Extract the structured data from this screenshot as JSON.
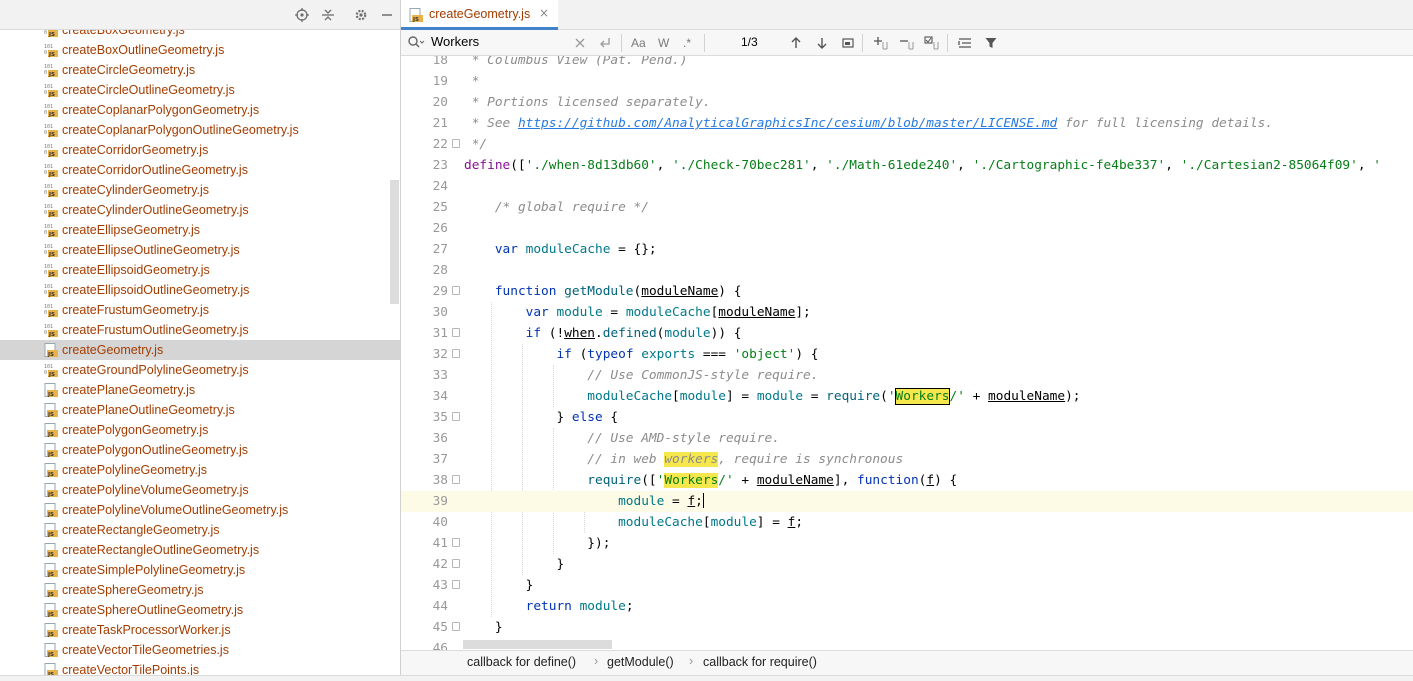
{
  "project_tree": {
    "files": [
      {
        "name": "createBoxGeometry.js",
        "icon": "js-binary-icon"
      },
      {
        "name": "createBoxOutlineGeometry.js",
        "icon": "js-binary-icon"
      },
      {
        "name": "createCircleGeometry.js",
        "icon": "js-binary-icon"
      },
      {
        "name": "createCircleOutlineGeometry.js",
        "icon": "js-binary-icon"
      },
      {
        "name": "createCoplanarPolygonGeometry.js",
        "icon": "js-binary-icon"
      },
      {
        "name": "createCoplanarPolygonOutlineGeometry.js",
        "icon": "js-binary-icon"
      },
      {
        "name": "createCorridorGeometry.js",
        "icon": "js-binary-icon"
      },
      {
        "name": "createCorridorOutlineGeometry.js",
        "icon": "js-binary-icon"
      },
      {
        "name": "createCylinderGeometry.js",
        "icon": "js-binary-icon"
      },
      {
        "name": "createCylinderOutlineGeometry.js",
        "icon": "js-binary-icon"
      },
      {
        "name": "createEllipseGeometry.js",
        "icon": "js-binary-icon"
      },
      {
        "name": "createEllipseOutlineGeometry.js",
        "icon": "js-binary-icon"
      },
      {
        "name": "createEllipsoidGeometry.js",
        "icon": "js-binary-icon"
      },
      {
        "name": "createEllipsoidOutlineGeometry.js",
        "icon": "js-binary-icon"
      },
      {
        "name": "createFrustumGeometry.js",
        "icon": "js-binary-icon"
      },
      {
        "name": "createFrustumOutlineGeometry.js",
        "icon": "js-binary-icon"
      },
      {
        "name": "createGeometry.js",
        "icon": "js-file-icon",
        "selected": true
      },
      {
        "name": "createGroundPolylineGeometry.js",
        "icon": "js-binary-icon"
      },
      {
        "name": "createPlaneGeometry.js",
        "icon": "js-file-icon"
      },
      {
        "name": "createPlaneOutlineGeometry.js",
        "icon": "js-file-icon"
      },
      {
        "name": "createPolygonGeometry.js",
        "icon": "js-file-icon"
      },
      {
        "name": "createPolygonOutlineGeometry.js",
        "icon": "js-file-icon"
      },
      {
        "name": "createPolylineGeometry.js",
        "icon": "js-file-icon"
      },
      {
        "name": "createPolylineVolumeGeometry.js",
        "icon": "js-file-icon"
      },
      {
        "name": "createPolylineVolumeOutlineGeometry.js",
        "icon": "js-file-icon"
      },
      {
        "name": "createRectangleGeometry.js",
        "icon": "js-file-icon"
      },
      {
        "name": "createRectangleOutlineGeometry.js",
        "icon": "js-file-icon"
      },
      {
        "name": "createSimplePolylineGeometry.js",
        "icon": "js-file-icon"
      },
      {
        "name": "createSphereGeometry.js",
        "icon": "js-file-icon"
      },
      {
        "name": "createSphereOutlineGeometry.js",
        "icon": "js-file-icon"
      },
      {
        "name": "createTaskProcessorWorker.js",
        "icon": "js-file-icon"
      },
      {
        "name": "createVectorTileGeometries.js",
        "icon": "js-file-icon"
      },
      {
        "name": "createVectorTilePoints.js",
        "icon": "js-file-icon"
      }
    ],
    "toolbar_icons": [
      "locate-icon",
      "collapse-all-icon",
      "gear-icon",
      "minimize-icon"
    ]
  },
  "editor": {
    "tab": {
      "label": "createGeometry.js",
      "close": "×"
    },
    "find": {
      "query": "Workers",
      "match_case": "Aa",
      "words": "W",
      "regex": ".*",
      "count": "1/3"
    },
    "breadcrumbs": [
      "callback for define()",
      "getModule()",
      "callback for require()"
    ],
    "colors": {
      "accent": "#4083c9",
      "keyword": "#0033b3",
      "string": "#067d17",
      "comment": "#8c8c8c",
      "file": "#a33c00",
      "highlight": "#f6e74d"
    },
    "lines": [
      {
        "n": "18",
        "fold": false,
        "indent": 0,
        "segs": [
          {
            "t": " * Columbus View (Pat. Pend.)",
            "c": "c-cm"
          }
        ]
      },
      {
        "n": "19",
        "fold": false,
        "indent": 0,
        "segs": [
          {
            "t": " *",
            "c": "c-cm"
          }
        ]
      },
      {
        "n": "20",
        "fold": false,
        "indent": 0,
        "segs": [
          {
            "t": " * Portions licensed separately.",
            "c": "c-cm"
          }
        ]
      },
      {
        "n": "21",
        "fold": false,
        "indent": 0,
        "segs": [
          {
            "t": " * See ",
            "c": "c-cm"
          },
          {
            "t": "https://github.com/AnalyticalGraphicsInc/cesium/blob/master/LICENSE.md",
            "c": "link"
          },
          {
            "t": " for full licensing details.",
            "c": "c-cm"
          }
        ]
      },
      {
        "n": "22",
        "fold": true,
        "indent": 0,
        "segs": [
          {
            "t": " */",
            "c": "c-cm"
          }
        ]
      },
      {
        "n": "23",
        "fold": false,
        "indent": 0,
        "segs": [
          {
            "t": "define",
            "c": "c-var"
          },
          {
            "t": "(["
          },
          {
            "t": "'./when-8d13db60'",
            "c": "c-str"
          },
          {
            "t": ", "
          },
          {
            "t": "'./Check-70bec281'",
            "c": "c-str"
          },
          {
            "t": ", "
          },
          {
            "t": "'./Math-61ede240'",
            "c": "c-str"
          },
          {
            "t": ", "
          },
          {
            "t": "'./Cartographic-fe4be337'",
            "c": "c-str"
          },
          {
            "t": ", "
          },
          {
            "t": "'./Cartesian2-85064f09'",
            "c": "c-str"
          },
          {
            "t": ", "
          },
          {
            "t": "'",
            "c": "c-str"
          }
        ]
      },
      {
        "n": "24",
        "fold": false,
        "indent": 0,
        "segs": []
      },
      {
        "n": "25",
        "fold": false,
        "indent": 1,
        "segs": [
          {
            "t": "/* global require */",
            "c": "c-cm"
          }
        ]
      },
      {
        "n": "26",
        "fold": false,
        "indent": 0,
        "segs": []
      },
      {
        "n": "27",
        "fold": false,
        "indent": 1,
        "segs": [
          {
            "t": "var ",
            "c": "c-kw"
          },
          {
            "t": "moduleCache",
            "c": "c-teal"
          },
          {
            "t": " = {};"
          }
        ]
      },
      {
        "n": "28",
        "fold": false,
        "indent": 0,
        "segs": []
      },
      {
        "n": "29",
        "fold": true,
        "indent": 1,
        "segs": [
          {
            "t": "function ",
            "c": "c-kw"
          },
          {
            "t": "getModule",
            "c": "c-fn"
          },
          {
            "t": "("
          },
          {
            "t": "moduleName",
            "c": "u"
          },
          {
            "t": ") {"
          }
        ]
      },
      {
        "n": "30",
        "fold": false,
        "indent": 2,
        "segs": [
          {
            "t": "var ",
            "c": "c-kw"
          },
          {
            "t": "module",
            "c": "c-teal"
          },
          {
            "t": " = "
          },
          {
            "t": "moduleCache",
            "c": "c-teal"
          },
          {
            "t": "["
          },
          {
            "t": "moduleName",
            "c": "u"
          },
          {
            "t": "];"
          }
        ]
      },
      {
        "n": "31",
        "fold": true,
        "indent": 2,
        "segs": [
          {
            "t": "if ",
            "c": "c-kw"
          },
          {
            "t": "(!"
          },
          {
            "t": "when",
            "c": "u"
          },
          {
            "t": "."
          },
          {
            "t": "defined",
            "c": "c-fn"
          },
          {
            "t": "("
          },
          {
            "t": "module",
            "c": "c-teal"
          },
          {
            "t": ")) {"
          }
        ]
      },
      {
        "n": "32",
        "fold": true,
        "indent": 3,
        "segs": [
          {
            "t": "if ",
            "c": "c-kw"
          },
          {
            "t": "("
          },
          {
            "t": "typeof ",
            "c": "c-kw"
          },
          {
            "t": "exports",
            "c": "c-teal"
          },
          {
            "t": " === "
          },
          {
            "t": "'object'",
            "c": "c-str"
          },
          {
            "t": ") {"
          }
        ]
      },
      {
        "n": "33",
        "fold": false,
        "indent": 4,
        "segs": [
          {
            "t": "// Use CommonJS-style require.",
            "c": "c-cm"
          }
        ]
      },
      {
        "n": "34",
        "fold": false,
        "indent": 4,
        "segs": [
          {
            "t": "moduleCache",
            "c": "c-teal"
          },
          {
            "t": "["
          },
          {
            "t": "module",
            "c": "c-teal"
          },
          {
            "t": "] = "
          },
          {
            "t": "module",
            "c": "c-teal"
          },
          {
            "t": " = "
          },
          {
            "t": "require",
            "c": "c-fn"
          },
          {
            "t": "("
          },
          {
            "t": "'",
            "c": "c-str"
          },
          {
            "t": "Workers",
            "c": "c-str hlb"
          },
          {
            "t": "/'",
            "c": "c-str"
          },
          {
            "t": " + "
          },
          {
            "t": "moduleName",
            "c": "u"
          },
          {
            "t": ");"
          }
        ]
      },
      {
        "n": "35",
        "fold": true,
        "indent": 3,
        "segs": [
          {
            "t": "} "
          },
          {
            "t": "else",
            "c": "c-kw"
          },
          {
            "t": " {"
          }
        ]
      },
      {
        "n": "36",
        "fold": false,
        "indent": 4,
        "segs": [
          {
            "t": "// Use AMD-style require.",
            "c": "c-cm"
          }
        ]
      },
      {
        "n": "37",
        "fold": false,
        "indent": 4,
        "segs": [
          {
            "t": "// in web ",
            "c": "c-cm"
          },
          {
            "t": "workers",
            "c": "c-cm hl"
          },
          {
            "t": ", require is synchronous",
            "c": "c-cm"
          }
        ]
      },
      {
        "n": "38",
        "fold": true,
        "indent": 4,
        "segs": [
          {
            "t": "require",
            "c": "c-fn"
          },
          {
            "t": "(["
          },
          {
            "t": "'",
            "c": "c-str"
          },
          {
            "t": "Workers",
            "c": "c-str hl"
          },
          {
            "t": "/'",
            "c": "c-str"
          },
          {
            "t": " + "
          },
          {
            "t": "moduleName",
            "c": "u"
          },
          {
            "t": "], "
          },
          {
            "t": "function",
            "c": "c-kw"
          },
          {
            "t": "("
          },
          {
            "t": "f",
            "c": "u"
          },
          {
            "t": ") {"
          }
        ]
      },
      {
        "n": "39",
        "fold": false,
        "indent": 5,
        "current": true,
        "segs": [
          {
            "t": "module",
            "c": "c-teal"
          },
          {
            "t": " = "
          },
          {
            "t": "f",
            "c": "u"
          },
          {
            "t": ";"
          }
        ]
      },
      {
        "n": "40",
        "fold": false,
        "indent": 5,
        "segs": [
          {
            "t": "moduleCache",
            "c": "c-teal"
          },
          {
            "t": "["
          },
          {
            "t": "module",
            "c": "c-teal"
          },
          {
            "t": "] = "
          },
          {
            "t": "f",
            "c": "u"
          },
          {
            "t": ";"
          }
        ]
      },
      {
        "n": "41",
        "fold": true,
        "indent": 4,
        "segs": [
          {
            "t": "});"
          }
        ]
      },
      {
        "n": "42",
        "fold": true,
        "indent": 3,
        "segs": [
          {
            "t": "}"
          }
        ]
      },
      {
        "n": "43",
        "fold": true,
        "indent": 2,
        "segs": [
          {
            "t": "}"
          }
        ]
      },
      {
        "n": "44",
        "fold": false,
        "indent": 2,
        "segs": [
          {
            "t": "return ",
            "c": "c-kw"
          },
          {
            "t": "module",
            "c": "c-teal"
          },
          {
            "t": ";"
          }
        ]
      },
      {
        "n": "45",
        "fold": true,
        "indent": 1,
        "segs": [
          {
            "t": "}"
          }
        ]
      },
      {
        "n": "46",
        "fold": false,
        "indent": 0,
        "segs": []
      }
    ]
  }
}
